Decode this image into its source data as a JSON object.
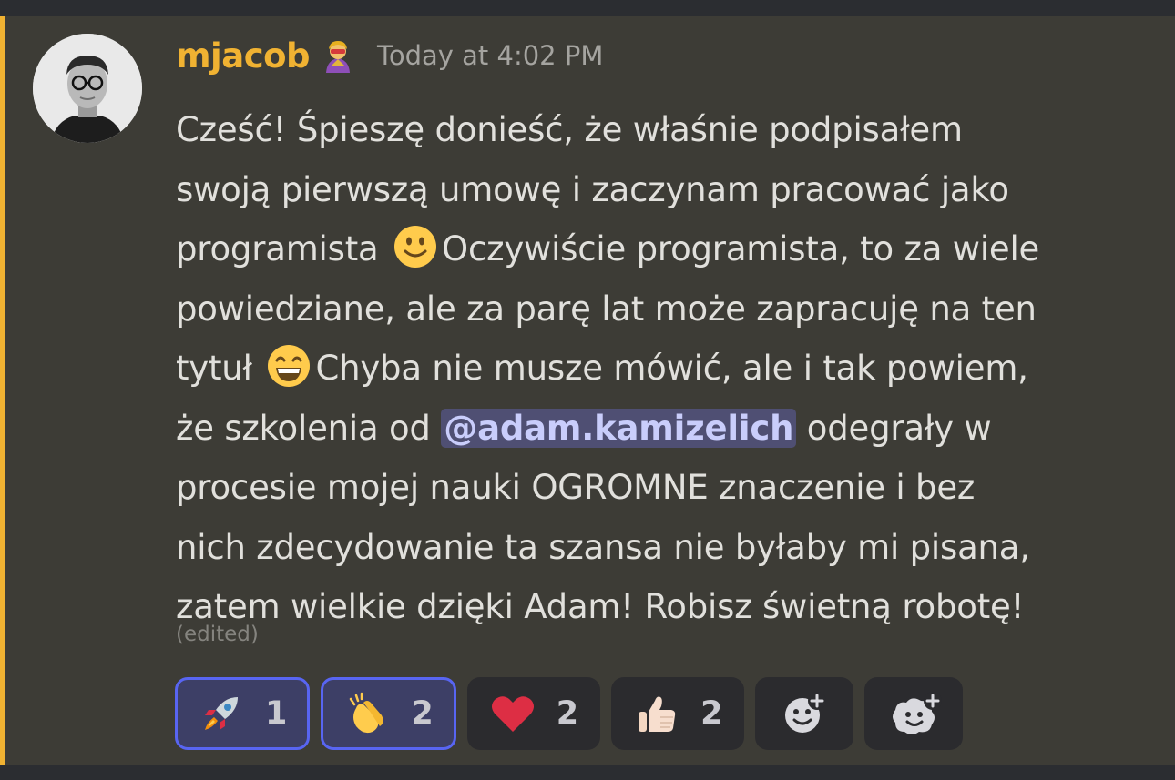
{
  "message": {
    "author": "mjacob",
    "role_icon": "superhero-emoji-icon",
    "timestamp": "Today at 4:02 PM",
    "edited_label": "(edited)",
    "mention": "@adam.kamizelich",
    "lines": [
      {
        "a": "Cześć! Śpieszę donieść, że właśnie podpisałem"
      },
      {
        "a": "swoją pierwszą umowę i zaczynam pracować jako"
      },
      {
        "a": "programista",
        "b": "Oczywiście programista, to za wiele"
      },
      {
        "a": "powiedziane, ale za parę lat może zapracuję na ten"
      },
      {
        "a": "tytuł",
        "b": "Chyba nie musze mówić, ale i tak powiem,"
      },
      {
        "a": "że szkolenia od",
        "b": "odegrały w"
      },
      {
        "a": "procesie mojej nauki OGROMNE znaczenie i bez"
      },
      {
        "a": "nich zdecydowanie ta szansa nie byłaby mi pisana,"
      },
      {
        "a": "zatem wielkie dzięki Adam! Robisz świetną robotę!"
      }
    ]
  },
  "reactions": [
    {
      "emoji": "rocket-icon",
      "count": "1",
      "selected": true
    },
    {
      "emoji": "clapping-hands-icon",
      "count": "2",
      "selected": true
    },
    {
      "emoji": "red-heart-icon",
      "count": "2",
      "selected": false
    },
    {
      "emoji": "thumbs-up-icon",
      "count": "2",
      "selected": false
    }
  ],
  "colors": {
    "author": "#f0b232",
    "highlight": "#f0b232",
    "mention_bg": "#4f4f73",
    "reaction_selected_border": "#5865f2"
  }
}
